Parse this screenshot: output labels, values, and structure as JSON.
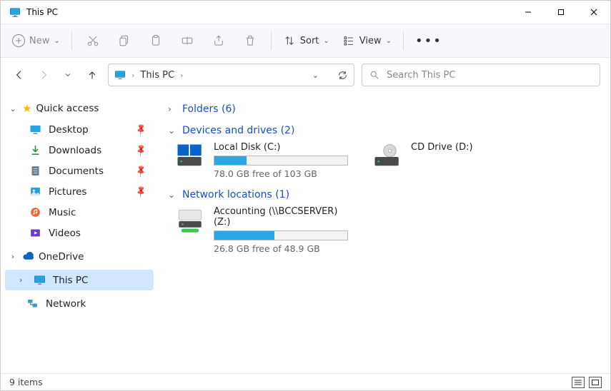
{
  "window": {
    "title": "This PC"
  },
  "toolbar": {
    "new_label": "New",
    "sort_label": "Sort",
    "view_label": "View"
  },
  "nav": {
    "address": {
      "location": "This PC"
    },
    "search_placeholder": "Search This PC"
  },
  "sidebar": {
    "quick_access": {
      "label": "Quick access",
      "items": [
        {
          "key": "desktop",
          "label": "Desktop",
          "pinned": true
        },
        {
          "key": "downloads",
          "label": "Downloads",
          "pinned": true
        },
        {
          "key": "documents",
          "label": "Documents",
          "pinned": true
        },
        {
          "key": "pictures",
          "label": "Pictures",
          "pinned": true
        },
        {
          "key": "music",
          "label": "Music",
          "pinned": false
        },
        {
          "key": "videos",
          "label": "Videos",
          "pinned": false
        }
      ]
    },
    "onedrive": {
      "label": "OneDrive"
    },
    "thispc": {
      "label": "This PC"
    },
    "network": {
      "label": "Network"
    }
  },
  "content": {
    "folders": {
      "label": "Folders (6)"
    },
    "devices": {
      "label": "Devices and drives (2)",
      "items": [
        {
          "name": "Local Disk (C:)",
          "free_text": "78.0 GB free of 103 GB",
          "fill_pct": 24
        },
        {
          "name": "CD Drive (D:)",
          "free_text": "",
          "fill_pct": 0,
          "nobar": true
        }
      ]
    },
    "network": {
      "label": "Network locations (1)",
      "items": [
        {
          "name": "Accounting (\\\\BCCSERVER) (Z:)",
          "free_text": "26.8 GB free of 48.9 GB",
          "fill_pct": 45
        }
      ]
    }
  },
  "status": {
    "text": "9 items"
  }
}
